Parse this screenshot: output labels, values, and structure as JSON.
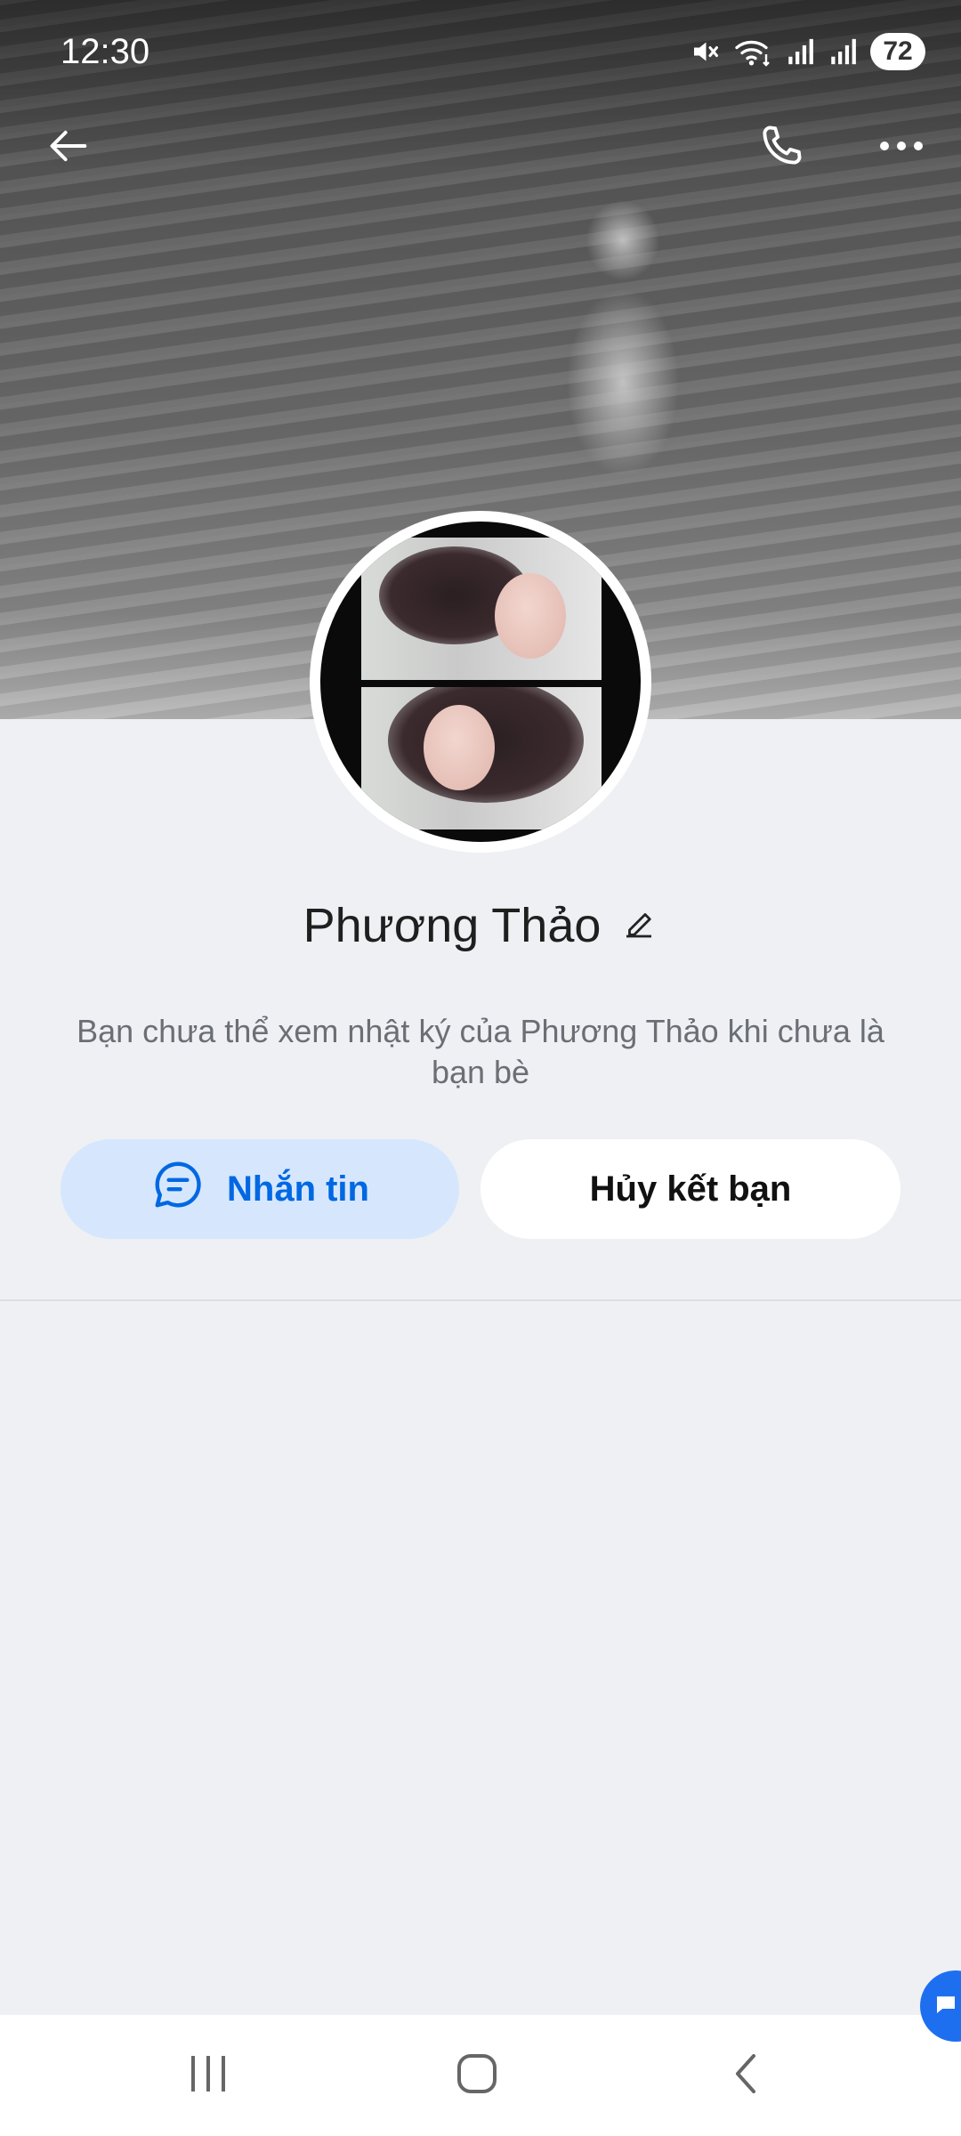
{
  "status_bar": {
    "time": "12:30",
    "battery": "72",
    "icons": [
      "mute-icon",
      "wifi-icon",
      "signal-icon",
      "signal-icon"
    ]
  },
  "nav": {
    "back_icon": "back-arrow-icon",
    "call_icon": "phone-icon",
    "more_icon": "more-dots-icon"
  },
  "profile": {
    "name": "Phương Thảo",
    "edit_icon": "pencil-icon",
    "notice": "Bạn chưa thể xem nhật ký của Phương Thảo khi chưa là bạn bè"
  },
  "actions": {
    "message_label": "Nhắn tin",
    "unfriend_label": "Hủy kết bạn"
  },
  "colors": {
    "accent": "#0068e3",
    "message_button_bg": "#d6e7fd",
    "page_bg": "#eef0f4"
  },
  "system_nav": [
    "recents-icon",
    "home-icon",
    "back-icon"
  ]
}
